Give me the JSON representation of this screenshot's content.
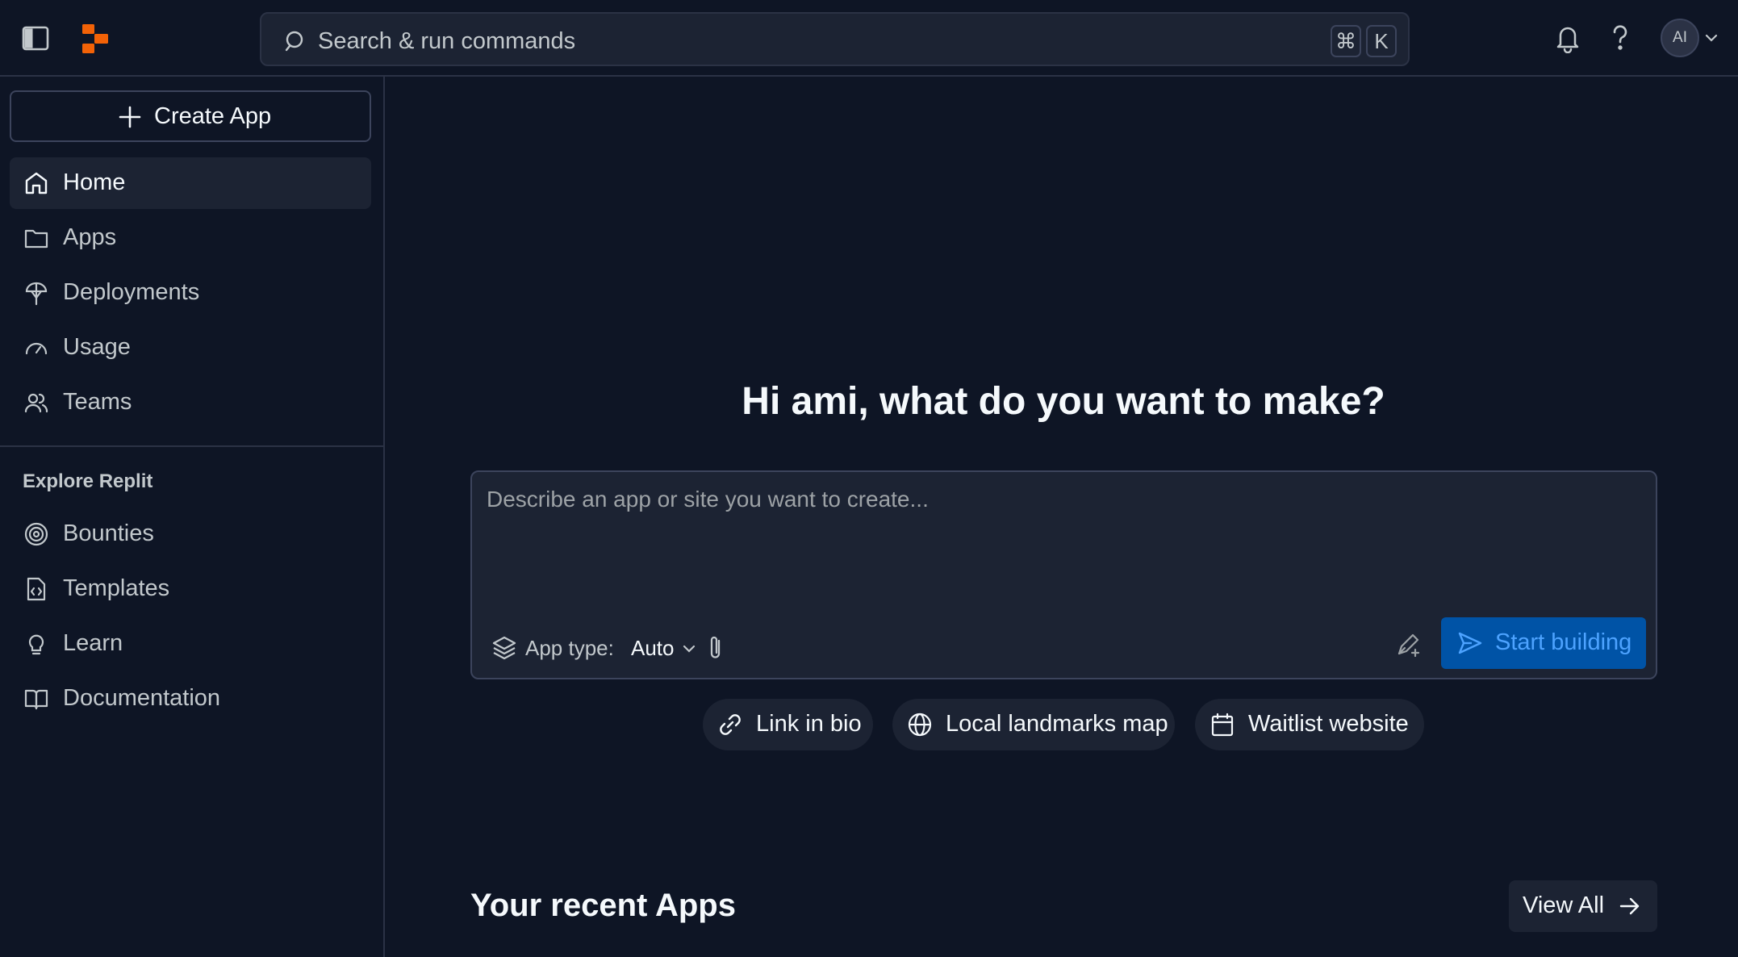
{
  "header": {
    "search_placeholder": "Search & run commands",
    "shortcut_cmd": "⌘",
    "shortcut_key": "K",
    "avatar_initials": "AI"
  },
  "sidebar": {
    "create_label": "Create App",
    "nav": [
      {
        "label": "Home",
        "icon": "home-icon",
        "active": true
      },
      {
        "label": "Apps",
        "icon": "folder-icon"
      },
      {
        "label": "Deployments",
        "icon": "deploy-icon"
      },
      {
        "label": "Usage",
        "icon": "gauge-icon"
      },
      {
        "label": "Teams",
        "icon": "users-icon"
      }
    ],
    "explore_title": "Explore Replit",
    "explore": [
      {
        "label": "Bounties",
        "icon": "spiral-icon"
      },
      {
        "label": "Templates",
        "icon": "template-file-icon"
      },
      {
        "label": "Learn",
        "icon": "lightbulb-icon"
      },
      {
        "label": "Documentation",
        "icon": "book-icon"
      }
    ]
  },
  "main": {
    "greeting": "Hi ami, what do you want to make?",
    "prompt_placeholder": "Describe an app or site you want to create...",
    "app_type_label": "App type:",
    "app_type_value": "Auto",
    "start_label": "Start building",
    "suggestions": [
      {
        "label": "Link in bio",
        "icon": "link-icon"
      },
      {
        "label": "Local landmarks map",
        "icon": "globe-icon"
      },
      {
        "label": "Waitlist website",
        "icon": "calendar-icon"
      }
    ],
    "recent_title": "Your recent Apps",
    "view_all_label": "View All"
  },
  "colors": {
    "background": "#0e1525",
    "surface": "#1c2333",
    "border": "#2b3245",
    "brand_orange": "#f26207",
    "primary_button": "#0053a6",
    "primary_text": "#4da3ff"
  }
}
